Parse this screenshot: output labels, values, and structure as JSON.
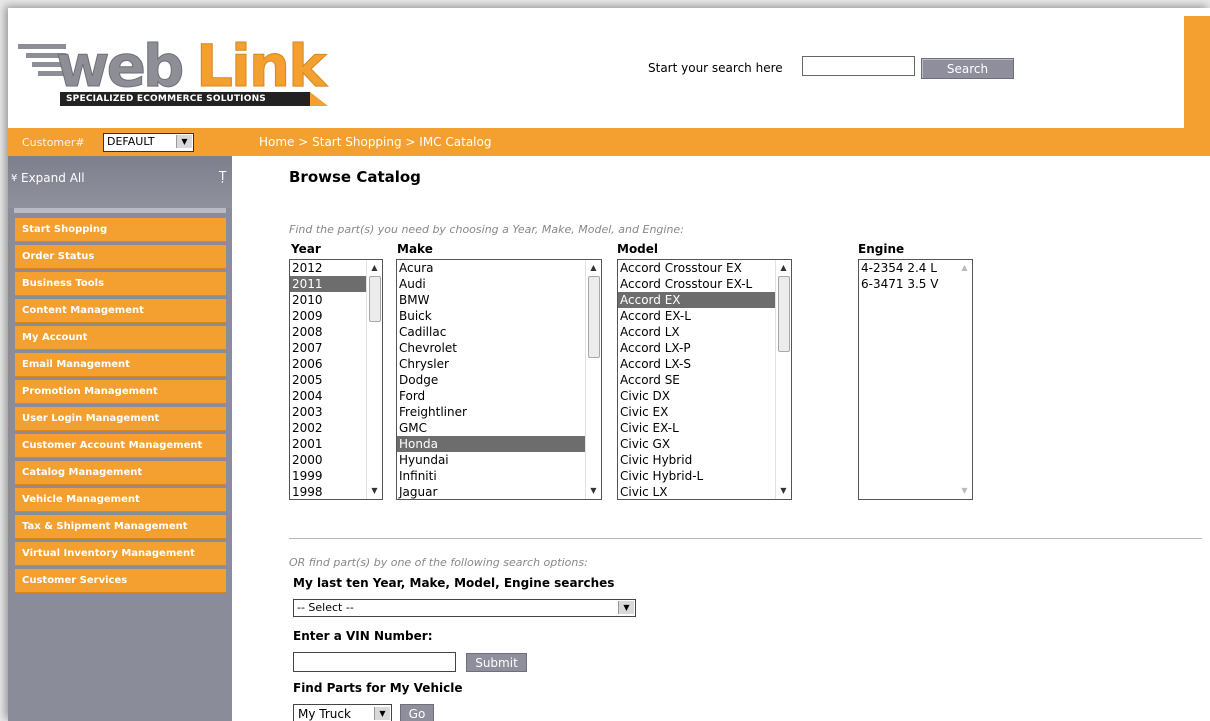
{
  "header": {
    "logo_text": "web Link",
    "logo_tagline": "SPECIALIZED ECOMMERCE SOLUTIONS",
    "search_label": "Start your search here",
    "search_placeholder": "",
    "search_button": "Search"
  },
  "topbar": {
    "customer_label": "Customer#",
    "customer_value": "DEFAULT",
    "breadcrumb": "Home > Start Shopping > IMC Catalog"
  },
  "sidebar": {
    "expand_all": "Expand All",
    "items": [
      {
        "label": "Start Shopping"
      },
      {
        "label": "Order Status"
      },
      {
        "label": "Business Tools"
      },
      {
        "label": "Content Management"
      },
      {
        "label": "My Account"
      },
      {
        "label": "Email Management"
      },
      {
        "label": "Promotion Management"
      },
      {
        "label": "User Login Management"
      },
      {
        "label": "Customer Account Management"
      },
      {
        "label": "Catalog Management"
      },
      {
        "label": "Vehicle Management"
      },
      {
        "label": "Tax & Shipment Management"
      },
      {
        "label": "Virtual Inventory Management"
      },
      {
        "label": "Customer Services"
      }
    ]
  },
  "main": {
    "title": "Browse Catalog",
    "instructions": "Find the part(s) you need by choosing a Year, Make, Model, and Engine:",
    "year": {
      "label": "Year",
      "options": [
        "2012",
        "2011",
        "2010",
        "2009",
        "2008",
        "2007",
        "2006",
        "2005",
        "2004",
        "2003",
        "2002",
        "2001",
        "2000",
        "1999",
        "1998"
      ],
      "selected": "2011"
    },
    "make": {
      "label": "Make",
      "options": [
        "Acura",
        "Audi",
        "BMW",
        "Buick",
        "Cadillac",
        "Chevrolet",
        "Chrysler",
        "Dodge",
        "Ford",
        "Freightliner",
        "GMC",
        "Honda",
        "Hyundai",
        "Infiniti",
        "Jaguar"
      ],
      "selected": "Honda"
    },
    "model": {
      "label": "Model",
      "options": [
        "Accord Crosstour EX",
        "Accord Crosstour EX-L",
        "Accord EX",
        "Accord EX-L",
        "Accord LX",
        "Accord LX-P",
        "Accord LX-S",
        "Accord SE",
        "Civic DX",
        "Civic EX",
        "Civic EX-L",
        "Civic GX",
        "Civic Hybrid",
        "Civic Hybrid-L",
        "Civic LX"
      ],
      "selected": "Accord EX"
    },
    "engine": {
      "label": "Engine",
      "options": [
        "4-2354 2.4 L",
        "6-3471 3.5 V"
      ],
      "selected": ""
    },
    "or_text": "OR find part(s) by one of the following search options:",
    "last_searches_label": "My last ten Year, Make, Model, Engine searches",
    "last_searches_value": "-- Select --",
    "vin_label": "Enter a VIN Number:",
    "vin_value": "",
    "vin_submit": "Submit",
    "vehicle_label": "Find Parts for My Vehicle",
    "vehicle_value": "My Truck",
    "vehicle_go": "Go"
  },
  "colors": {
    "accent_orange": "#f3a031",
    "sidebar_gray": "#8a8c99",
    "button_gray": "#8e8e9c",
    "logo_gray": "#8d8e96"
  }
}
